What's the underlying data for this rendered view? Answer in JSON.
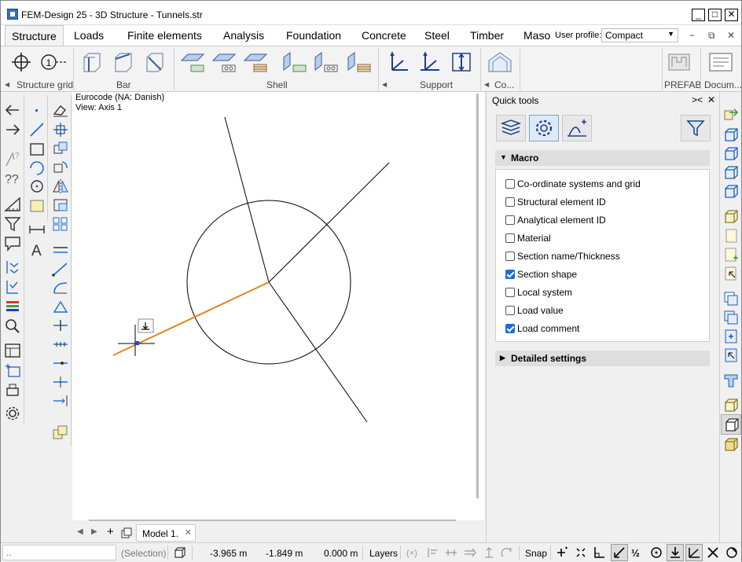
{
  "window": {
    "title": "FEM-Design 25 - 3D Structure - Tunnels.str",
    "controls": {
      "minimize": "_",
      "maximize": "□",
      "close": "✕"
    }
  },
  "ribbon_tabs": [
    "Structure",
    "Loads",
    "Finite elements",
    "Analysis",
    "Foundation",
    "Concrete",
    "Steel",
    "Timber",
    "Maso"
  ],
  "user_profile": {
    "label": "User profile:",
    "value": "Compact"
  },
  "ribbon_controls": {
    "minimize": "−",
    "restore": "⧉",
    "close": "✕"
  },
  "ribbon_groups": [
    {
      "label": "Structure grid",
      "icons": [
        "point-grid-icon",
        "numbered-grid-icon"
      ]
    },
    {
      "label": "Bar",
      "icons": [
        "column-icon",
        "beam-icon",
        "truss-icon"
      ]
    },
    {
      "label": "Shell",
      "icons": [
        "plate-icon",
        "slab-icon",
        "profiled-plate-icon",
        "wall-icon",
        "wall-slab-icon",
        "profiled-wall-icon"
      ]
    },
    {
      "label": "Support",
      "icons": [
        "point-support-icon",
        "line-support-icon",
        "surface-support-icon"
      ]
    },
    {
      "label": "Co...",
      "icons": [
        "cover-icon"
      ]
    },
    {
      "label": "PREFAB",
      "icons": [
        "prefab-icon"
      ]
    },
    {
      "label": "Docum...",
      "icons": [
        "documentation-icon"
      ]
    }
  ],
  "canvas": {
    "code_line": "Eurocode (NA: Danish)",
    "view_line": "View: Axis 1"
  },
  "model_tab": {
    "label": "Model 1.",
    "close": "✕"
  },
  "quick_tools": {
    "title": "Quick tools",
    "controls": {
      "collapse": "><",
      "close": "✕"
    },
    "macro_header": "Macro",
    "macro_items": [
      {
        "label": "Co-ordinate systems and grid",
        "checked": false
      },
      {
        "label": "Structural element ID",
        "checked": false
      },
      {
        "label": "Analytical element ID",
        "checked": false
      },
      {
        "label": "Material",
        "checked": false
      },
      {
        "label": "Section name/Thickness",
        "checked": false
      },
      {
        "label": "Section shape",
        "checked": true
      },
      {
        "label": "Local system",
        "checked": false
      },
      {
        "label": "Load value",
        "checked": false
      },
      {
        "label": "Load comment",
        "checked": true
      }
    ],
    "detailed_header": "Detailed settings"
  },
  "statusbar": {
    "selection": "(Selection)",
    "x": "-3.965 m",
    "y": "-1.849 m",
    "z": "0.000 m",
    "layers": "Layers",
    "snap": "Snap"
  },
  "colors": {
    "accent": "#1a6ed8",
    "bar_highlight": "#e8821a",
    "selection_square": "#2f3fd6"
  }
}
